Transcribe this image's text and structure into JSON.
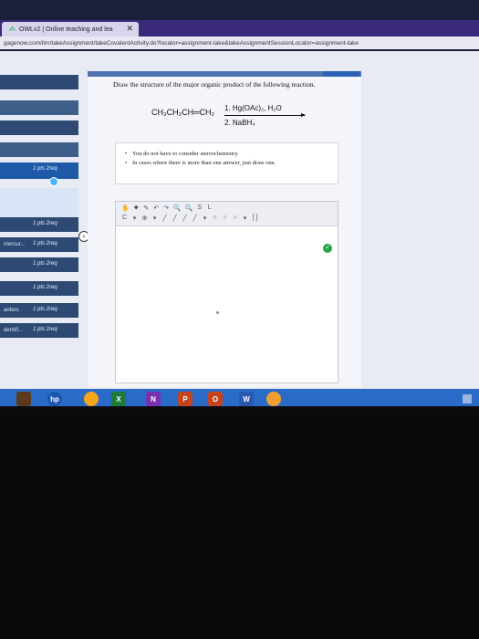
{
  "browser": {
    "tab_title": "OWLv2 | Online teaching and lea",
    "url": "gagenow.com/ilrn/takeAssignment/takeCovalentActivity.do?locator=assignment-take&takeAssignmentSessionLocator=assignment-take"
  },
  "sidebar": {
    "items": [
      {
        "left": "",
        "pts": ""
      },
      {
        "left": "",
        "pts": ""
      },
      {
        "left": "",
        "pts": ""
      },
      {
        "left": "",
        "pts": ""
      },
      {
        "left": "",
        "pts": "1 pts  2req"
      },
      {
        "left": "",
        "pts": "1 pts  2req"
      },
      {
        "left": "mercur...",
        "pts": "1 pts  2req"
      },
      {
        "left": "",
        "pts": "1 pts  2req"
      },
      {
        "left": "",
        "pts": "1 pts  2req"
      },
      {
        "left": "anters",
        "pts": "1 pts  2req"
      },
      {
        "left": "dentifi...",
        "pts": "1 pts  2req"
      }
    ]
  },
  "question": {
    "prompt": "Draw the structure of the major organic product of the following reaction.",
    "reactant": "CH₃CH₂CH═CH₂",
    "reagent_1": "1. Hg(OAc)₂, H₂O",
    "reagent_2": "2. NaBH₄",
    "notes": [
      "You do not have to consider stereochemistry.",
      "In cases where there is more than one answer, just draw one."
    ]
  },
  "editor": {
    "toolbar_row1": [
      "✋",
      "⬥",
      "✎",
      "↶",
      "↷",
      "🔍",
      "🔍",
      "S",
      "L"
    ],
    "toolbar_row2": [
      "C",
      "▾",
      "⊕",
      "▾",
      "╱",
      "╱",
      "╱",
      "╱",
      "▾",
      "○",
      "○",
      "○",
      "▾",
      "[ ]"
    ]
  },
  "taskbar": {
    "icons": [
      {
        "label": "hp",
        "color": "#1a56b0"
      },
      {
        "label": "",
        "color": "#f4a51c"
      },
      {
        "label": "X",
        "color": "#1f7a3a"
      },
      {
        "label": "N",
        "color": "#7a2fb0"
      },
      {
        "label": "P",
        "color": "#c4441f"
      },
      {
        "label": "O",
        "color": "#c4441f"
      },
      {
        "label": "W",
        "color": "#2b58b0"
      },
      {
        "label": "",
        "color": "#f0a030"
      }
    ]
  }
}
